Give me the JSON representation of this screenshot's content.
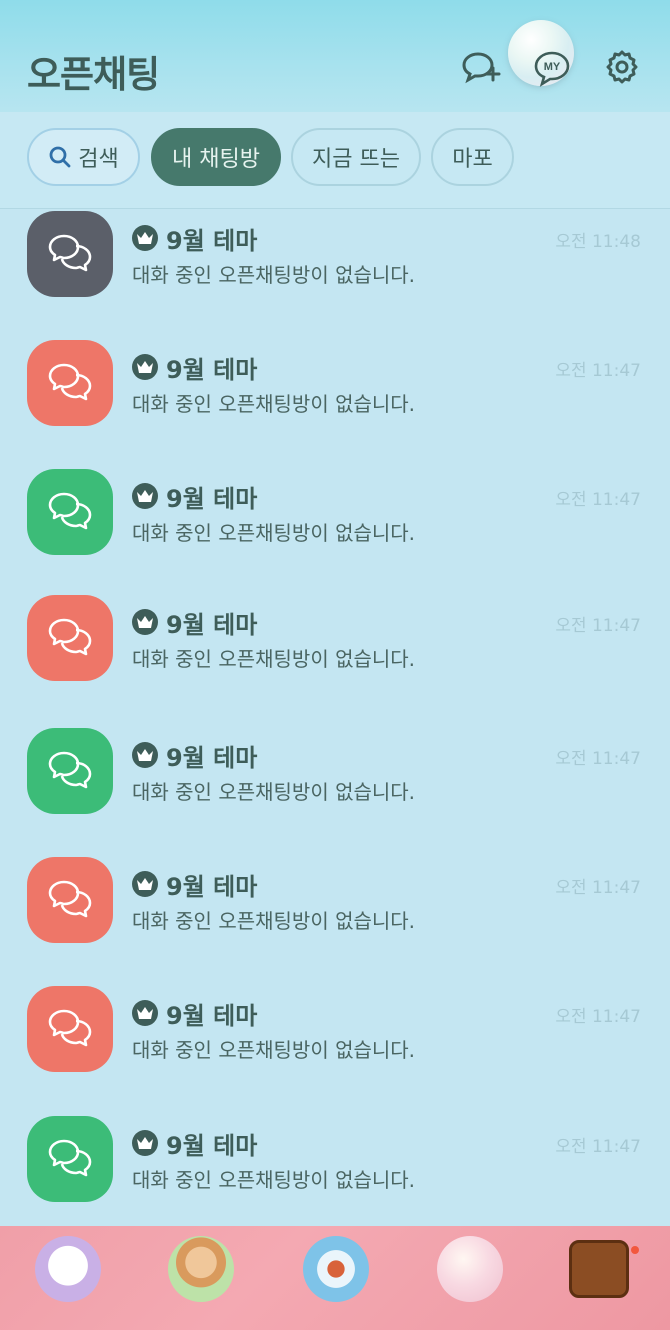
{
  "header": {
    "title": "오픈채팅",
    "my_label": "MY"
  },
  "filters": {
    "search": "검색",
    "my_rooms": "내 채팅방",
    "trending": "지금 뜨는",
    "mapo": "마포"
  },
  "colors": {
    "gray": "#5b5f69",
    "red": "#ee7668",
    "green": "#3cbc78"
  },
  "rooms": [
    {
      "name": "9월 테마",
      "message": "대화 중인 오픈채팅방이 없습니다.",
      "time": "오전 11:48",
      "color": "gray"
    },
    {
      "name": "9월 테마",
      "message": "대화 중인 오픈채팅방이 없습니다.",
      "time": "오전 11:47",
      "color": "red"
    },
    {
      "name": "9월 테마",
      "message": "대화 중인 오픈채팅방이 없습니다.",
      "time": "오전 11:47",
      "color": "green"
    },
    {
      "name": "9월 테마",
      "message": "대화 중인 오픈채팅방이 없습니다.",
      "time": "오전 11:47",
      "color": "red"
    },
    {
      "name": "9월 테마",
      "message": "대화 중인 오픈채팅방이 없습니다.",
      "time": "오전 11:47",
      "color": "green"
    },
    {
      "name": "9월 테마",
      "message": "대화 중인 오픈채팅방이 없습니다.",
      "time": "오전 11:47",
      "color": "red"
    },
    {
      "name": "9월 테마",
      "message": "대화 중인 오픈채팅방이 없습니다.",
      "time": "오전 11:47",
      "color": "red"
    },
    {
      "name": "9월 테마",
      "message": "대화 중인 오픈채팅방이 없습니다.",
      "time": "오전 11:47",
      "color": "green"
    }
  ],
  "bottom_nav": [
    {
      "name": "friends-tab-icon"
    },
    {
      "name": "chats-tab-icon"
    },
    {
      "name": "view-tab-icon"
    },
    {
      "name": "openchat-tab-icon"
    },
    {
      "name": "more-tab-icon"
    }
  ]
}
